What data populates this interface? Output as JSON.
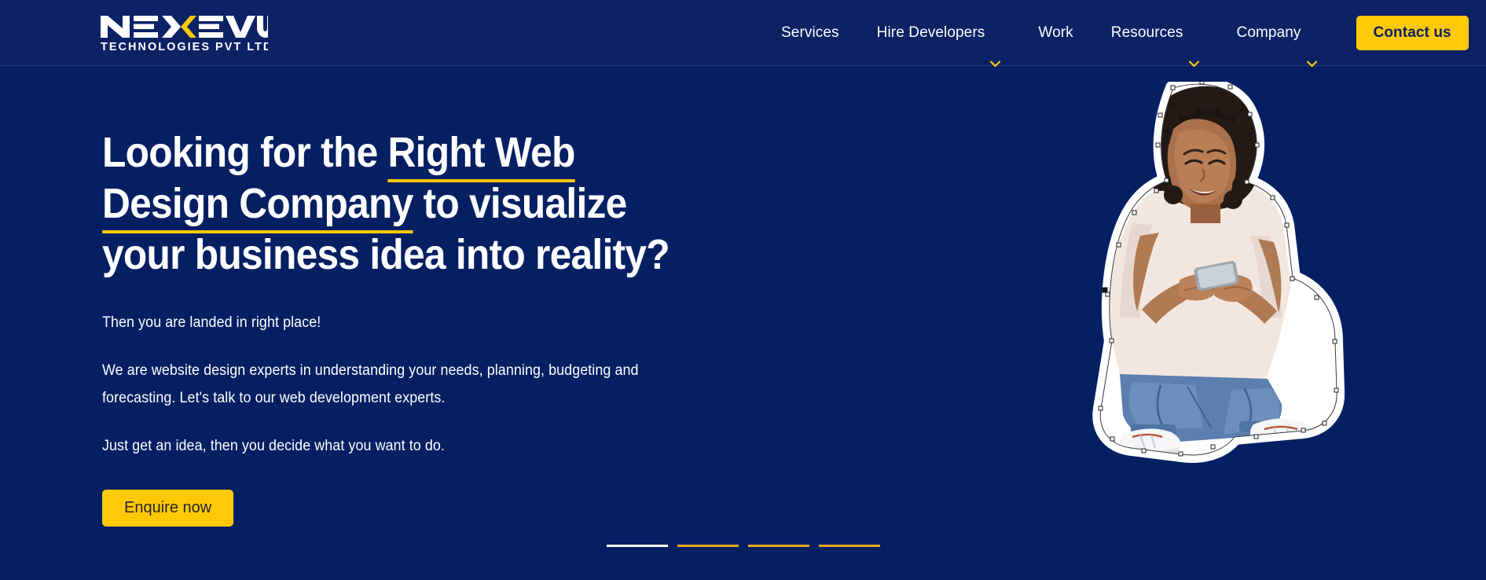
{
  "header": {
    "logo": {
      "name": "NEXEVO",
      "tagline": "TECHNOLOGIES PVT LTD",
      "word_white": "NE",
      "word_accent": "X",
      "word_white2": "EVO",
      "colors": {
        "text": "#FFFFFF",
        "accent": "#FFC907"
      }
    },
    "background": "#0C2265",
    "nav_items": [
      {
        "label": "Services",
        "has_dropdown": false,
        "icon": ""
      },
      {
        "label": "Hire Developers",
        "has_dropdown": true,
        "icon": "chevron-down-icon"
      },
      {
        "label": "Work",
        "has_dropdown": false,
        "icon": ""
      },
      {
        "label": "Resources",
        "has_dropdown": true,
        "icon": "chevron-down-icon"
      },
      {
        "label": "Company",
        "has_dropdown": true,
        "icon": "chevron-down-icon"
      }
    ],
    "contact_button": {
      "label": "Contact us",
      "bg": "#FFC907",
      "color": "#0C2265"
    }
  },
  "hero": {
    "background": "#042063",
    "headline": {
      "line1_plain": "Looking for the ",
      "line1_underlined": "Right Web",
      "line2_underlined": "Design Company",
      "line2_plain": " to visualize",
      "line3": "your business idea into reality?",
      "underline_color": "#FFC907",
      "text_color": "#FFFFFF"
    },
    "lede": "Then you are landed in right place!",
    "paragraph1": "We are website design experts in understanding your needs, planning, budgeting and forecasting. Let's talk to our web development experts.",
    "paragraph2": "Just get an idea, then you decide what you want to do.",
    "cta_button": {
      "label": "Enquire now",
      "bg": "#FFC907",
      "color": "#23272E"
    },
    "figure": {
      "alt": "Young woman sitting cross-legged using a smartphone, sticker cutout with white outline",
      "style": "photo-cutout"
    },
    "indicators": {
      "count": 4,
      "active_index": 0,
      "active_color": "#FFFFFF",
      "idle_color": "#E8A81C"
    }
  }
}
